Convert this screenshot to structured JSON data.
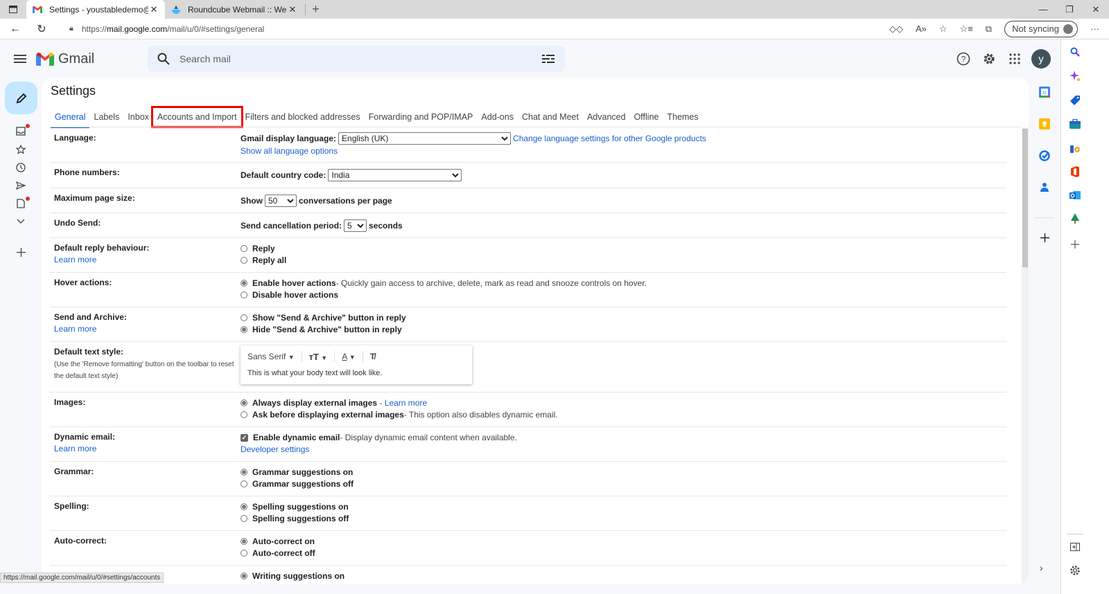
{
  "browser": {
    "tabs": [
      {
        "title": "Settings - youstabledemo@gmai",
        "active": true,
        "icon": "gmail-icon"
      },
      {
        "title": "Roundcube Webmail :: Welcome",
        "active": false,
        "icon": "roundcube-icon"
      }
    ],
    "url_prefix": "https://",
    "url_host": "mail.google.com",
    "url_path": "/mail/u/0/#settings/general",
    "sync_label": "Not syncing",
    "status_url": "https://mail.google.com/mail/u/0/#settings/accounts"
  },
  "gmail": {
    "logo_text": "Gmail",
    "search_placeholder": "Search mail",
    "avatar_initial": "y"
  },
  "settings": {
    "title": "Settings",
    "tabs": [
      {
        "label": "General",
        "active": true
      },
      {
        "label": "Labels"
      },
      {
        "label": "Inbox"
      },
      {
        "label": "Accounts and Import",
        "highlighted": true
      },
      {
        "label": "Filters and blocked addresses"
      },
      {
        "label": "Forwarding and POP/IMAP"
      },
      {
        "label": "Add-ons"
      },
      {
        "label": "Chat and Meet"
      },
      {
        "label": "Advanced"
      },
      {
        "label": "Offline"
      },
      {
        "label": "Themes"
      }
    ],
    "language": {
      "label": "Language:",
      "field_label": "Gmail display language:",
      "selected": "English (UK)",
      "change_link": "Change language settings for other Google products",
      "show_all_link": "Show all language options"
    },
    "phone": {
      "label": "Phone numbers:",
      "field_label": "Default country code:",
      "selected": "India"
    },
    "page_size": {
      "label": "Maximum page size:",
      "prefix": "Show",
      "selected": "50",
      "suffix": "conversations per page"
    },
    "undo_send": {
      "label": "Undo Send:",
      "field_label": "Send cancellation period:",
      "selected": "5",
      "suffix": "seconds"
    },
    "reply": {
      "label": "Default reply behaviour:",
      "learn_more": "Learn more",
      "options": [
        {
          "label": "Reply",
          "checked": false
        },
        {
          "label": "Reply all",
          "checked": false
        }
      ]
    },
    "hover": {
      "label": "Hover actions:",
      "options": [
        {
          "label": "Enable hover actions",
          "desc": " - Quickly gain access to archive, delete, mark as read and snooze controls on hover.",
          "checked": true
        },
        {
          "label": "Disable hover actions",
          "checked": false
        }
      ]
    },
    "send_archive": {
      "label": "Send and Archive:",
      "learn_more": "Learn more",
      "options": [
        {
          "label": "Show \"Send & Archive\" button in reply",
          "checked": false
        },
        {
          "label": "Hide \"Send & Archive\" button in reply",
          "checked": true
        }
      ]
    },
    "text_style": {
      "label": "Default text style:",
      "sub": "(Use the 'Remove formatting' button on the toolbar to reset the default text style)",
      "font": "Sans Serif",
      "preview": "This is what your body text will look like."
    },
    "images": {
      "label": "Images:",
      "options": [
        {
          "label": "Always display external images",
          "link": "Learn more",
          "checked": true
        },
        {
          "label": "Ask before displaying external images",
          "desc": " - This option also disables dynamic email.",
          "checked": false
        }
      ]
    },
    "dynamic": {
      "label": "Dynamic email:",
      "learn_more": "Learn more",
      "option": "Enable dynamic email",
      "desc": " - Display dynamic email content when available.",
      "checked": true,
      "dev_link": "Developer settings"
    },
    "grammar": {
      "label": "Grammar:",
      "options": [
        {
          "label": "Grammar suggestions on",
          "checked": true
        },
        {
          "label": "Grammar suggestions off",
          "checked": false
        }
      ]
    },
    "spelling": {
      "label": "Spelling:",
      "options": [
        {
          "label": "Spelling suggestions on",
          "checked": true
        },
        {
          "label": "Spelling suggestions off",
          "checked": false
        }
      ]
    },
    "autocorrect": {
      "label": "Auto-correct:",
      "options": [
        {
          "label": "Auto-correct on",
          "checked": true
        },
        {
          "label": "Auto-correct off",
          "checked": false
        }
      ]
    },
    "writing": {
      "options": [
        {
          "label": "Writing suggestions on",
          "checked": true
        }
      ]
    }
  },
  "colors": {
    "accent": "#0b57d0",
    "highlight_box": "#e00000",
    "compose_bg": "#c2e7ff",
    "search_bg": "#eaf1fb",
    "badge": "#d93025"
  }
}
